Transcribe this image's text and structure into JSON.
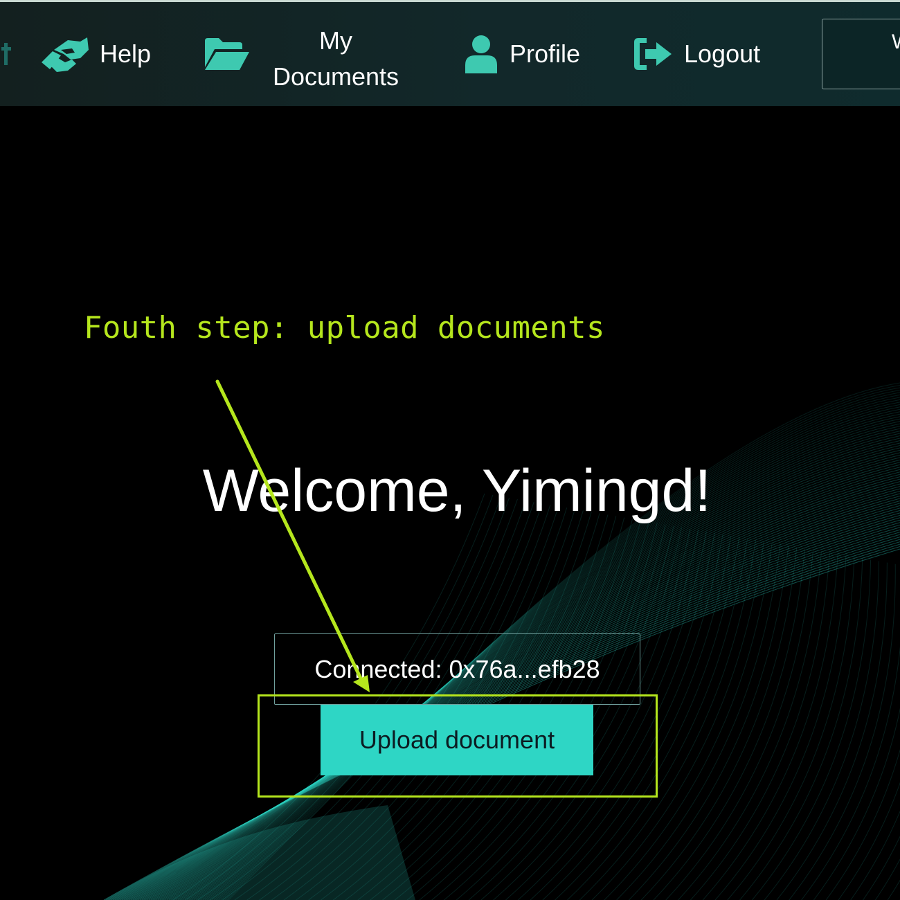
{
  "nav": {
    "items": [
      {
        "label": "Help",
        "icon": "handshake-icon"
      },
      {
        "label": "My Documents",
        "icon": "folder-open-icon"
      },
      {
        "label": "Profile",
        "icon": "user-icon"
      },
      {
        "label": "Logout",
        "icon": "logout-icon"
      }
    ],
    "right_box_text": "W"
  },
  "annotation": {
    "text": "Fouth step: upload documents",
    "color": "#b5e61d"
  },
  "main": {
    "welcome": "Welcome, Yimingd!",
    "connected": "Connected: 0x76a...efb28",
    "upload_button": "Upload document"
  },
  "colors": {
    "accent": "#2ed6c5",
    "nav_icon": "#3ec9b0",
    "annotation": "#b5e61d",
    "background": "#000000"
  }
}
